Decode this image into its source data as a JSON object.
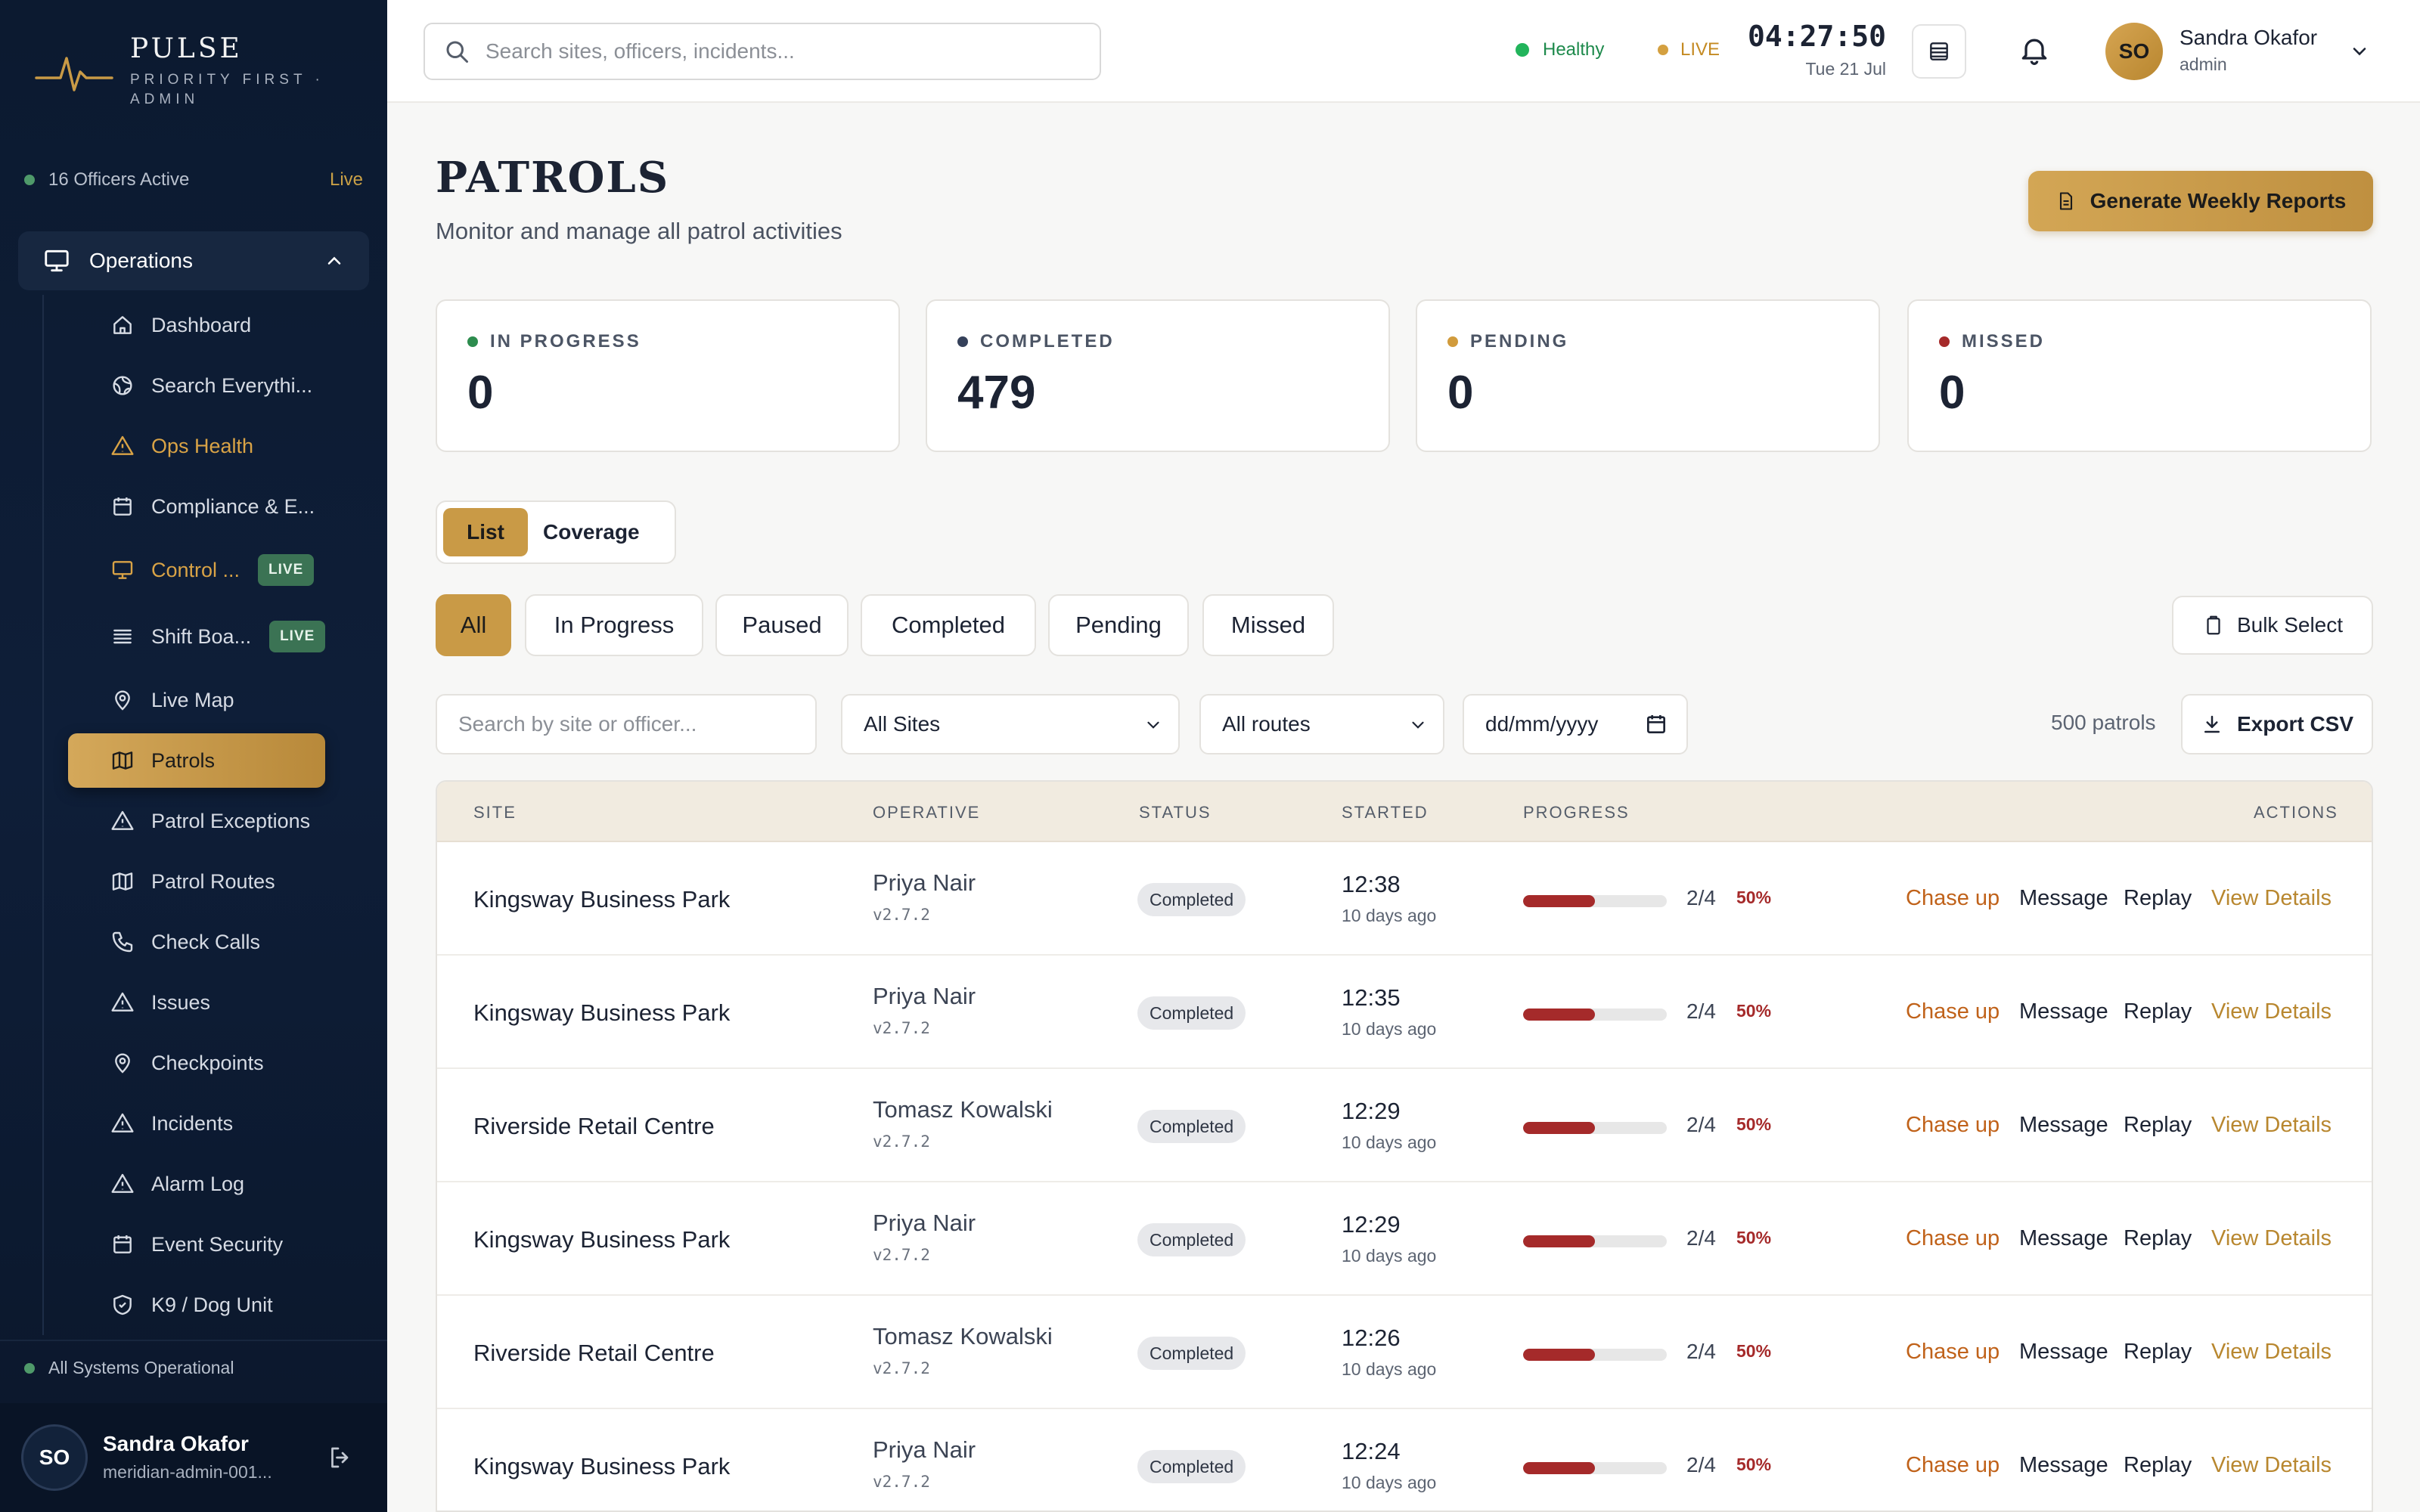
{
  "brand": {
    "name": "PULSE",
    "subtitle": "PRIORITY FIRST · ADMIN"
  },
  "sidebar": {
    "officers_active": "16 Officers Active",
    "live_label": "Live",
    "group_label": "Operations",
    "items": [
      {
        "label": "Dashboard",
        "icon": "home-icon"
      },
      {
        "label": "Search Everythi...",
        "icon": "globe-icon"
      },
      {
        "label": "Ops Health",
        "icon": "warning-icon"
      },
      {
        "label": "Compliance & E...",
        "icon": "calendar-icon"
      },
      {
        "label": "Control ...",
        "icon": "monitor-icon",
        "badge": "LIVE"
      },
      {
        "label": "Shift Boa...",
        "icon": "list-icon",
        "badge": "LIVE"
      },
      {
        "label": "Live Map",
        "icon": "map-pin-icon"
      },
      {
        "label": "Patrols",
        "icon": "map-icon"
      },
      {
        "label": "Patrol Exceptions",
        "icon": "warning-icon"
      },
      {
        "label": "Patrol Routes",
        "icon": "map-icon"
      },
      {
        "label": "Check Calls",
        "icon": "phone-icon"
      },
      {
        "label": "Issues",
        "icon": "warning-icon"
      },
      {
        "label": "Checkpoints",
        "icon": "map-pin-icon"
      },
      {
        "label": "Incidents",
        "icon": "warning-icon"
      },
      {
        "label": "Alarm Log",
        "icon": "warning-icon"
      },
      {
        "label": "Event Security",
        "icon": "calendar-icon"
      },
      {
        "label": "K9 / Dog Unit",
        "icon": "shield-icon"
      }
    ],
    "system_status": "All Systems Operational",
    "user": {
      "initials": "SO",
      "name": "Sandra Okafor",
      "id": "meridian-admin-001..."
    }
  },
  "topbar": {
    "search_placeholder": "Search sites, officers, incidents...",
    "health": "Healthy",
    "live": "LIVE",
    "time": "04:27:50",
    "date": "Tue 21 Jul",
    "user": {
      "initials": "SO",
      "name": "Sandra Okafor",
      "role": "admin"
    }
  },
  "page": {
    "title": "PATROLS",
    "subtitle": "Monitor and manage all patrol activities",
    "generate_label": "Generate Weekly Reports"
  },
  "stats": [
    {
      "label": "IN PROGRESS",
      "value": "0",
      "color": "#2d8c4e"
    },
    {
      "label": "COMPLETED",
      "value": "479",
      "color": "#35415a"
    },
    {
      "label": "PENDING",
      "value": "0",
      "color": "#d19b3c"
    },
    {
      "label": "MISSED",
      "value": "0",
      "color": "#a52a2a"
    }
  ],
  "view_toggle": {
    "list": "List",
    "coverage": "Coverage"
  },
  "filters": [
    "All",
    "In Progress",
    "Paused",
    "Completed",
    "Pending",
    "Missed"
  ],
  "bulk_label": "Bulk Select",
  "controls": {
    "site_search_placeholder": "Search by site or officer...",
    "sites_selected": "All Sites",
    "routes_selected": "All routes",
    "date_placeholder": "dd/mm/yyyy",
    "count": "500 patrols",
    "export_label": "Export CSV"
  },
  "table": {
    "columns": [
      "SITE",
      "OPERATIVE",
      "STATUS",
      "STARTED",
      "PROGRESS",
      "ACTIONS"
    ],
    "actions": {
      "chase": "Chase up",
      "message": "Message",
      "replay": "Replay",
      "view": "View Details"
    },
    "rows": [
      {
        "site": "Kingsway Business Park",
        "operative": "Priya Nair",
        "version": "v2.7.2",
        "status": "Completed",
        "started": "12:38",
        "ago": "10 days ago",
        "progress_fraction": 0.5,
        "done": "2/4",
        "pct": "50%"
      },
      {
        "site": "Kingsway Business Park",
        "operative": "Priya Nair",
        "version": "v2.7.2",
        "status": "Completed",
        "started": "12:35",
        "ago": "10 days ago",
        "progress_fraction": 0.5,
        "done": "2/4",
        "pct": "50%"
      },
      {
        "site": "Riverside Retail Centre",
        "operative": "Tomasz Kowalski",
        "version": "v2.7.2",
        "status": "Completed",
        "started": "12:29",
        "ago": "10 days ago",
        "progress_fraction": 0.5,
        "done": "2/4",
        "pct": "50%"
      },
      {
        "site": "Kingsway Business Park",
        "operative": "Priya Nair",
        "version": "v2.7.2",
        "status": "Completed",
        "started": "12:29",
        "ago": "10 days ago",
        "progress_fraction": 0.5,
        "done": "2/4",
        "pct": "50%"
      },
      {
        "site": "Riverside Retail Centre",
        "operative": "Tomasz Kowalski",
        "version": "v2.7.2",
        "status": "Completed",
        "started": "12:26",
        "ago": "10 days ago",
        "progress_fraction": 0.5,
        "done": "2/4",
        "pct": "50%"
      },
      {
        "site": "Kingsway Business Park",
        "operative": "Priya Nair",
        "version": "v2.7.2",
        "status": "Completed",
        "started": "12:24",
        "ago": "10 days ago",
        "progress_fraction": 0.5,
        "done": "2/4",
        "pct": "50%"
      }
    ]
  }
}
